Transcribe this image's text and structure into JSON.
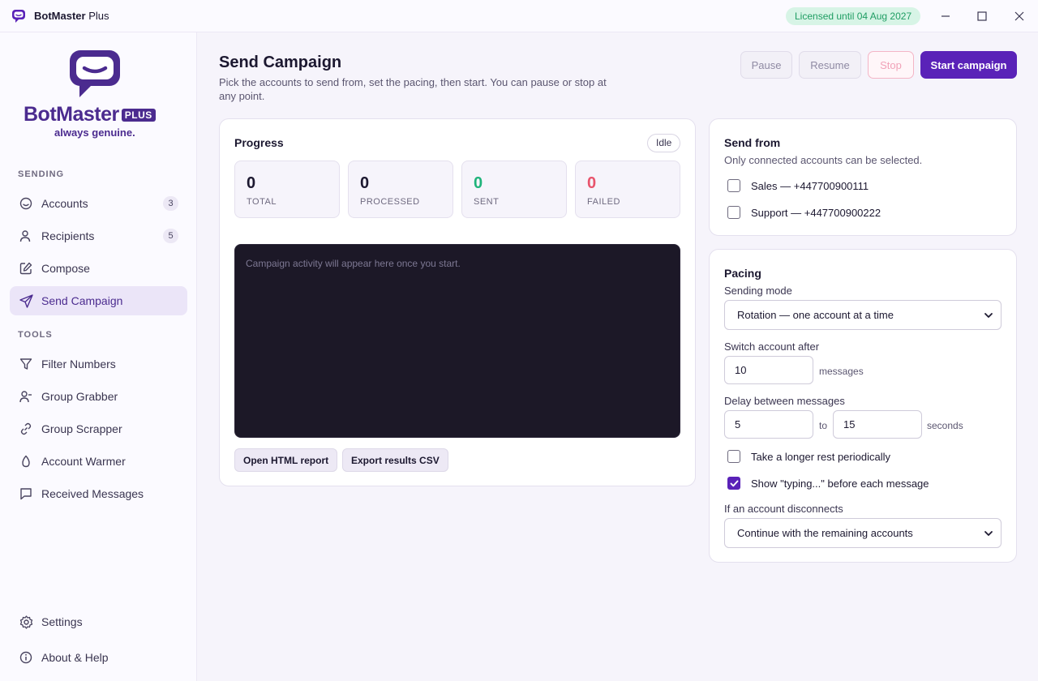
{
  "app": {
    "name_bold": "BotMaster",
    "name_rest": " Plus",
    "license": "Licensed until 04 Aug 2027"
  },
  "brand": {
    "name": "BotMaster",
    "plus": "PLUS",
    "tagline": "always genuine."
  },
  "sidebar": {
    "sending_label": "SENDING",
    "tools_label": "TOOLS",
    "sending_items": [
      {
        "label": "Accounts",
        "badge": "3"
      },
      {
        "label": "Recipients",
        "badge": "5"
      },
      {
        "label": "Compose"
      },
      {
        "label": "Send Campaign"
      }
    ],
    "tools_items": [
      {
        "label": "Filter Numbers"
      },
      {
        "label": "Group Grabber"
      },
      {
        "label": "Group Scrapper"
      },
      {
        "label": "Account Warmer"
      },
      {
        "label": "Received Messages"
      }
    ],
    "footer_items": [
      {
        "label": "Settings"
      },
      {
        "label": "About & Help"
      }
    ]
  },
  "header": {
    "title": "Send Campaign",
    "subtitle": "Pick the accounts to send from, set the pacing, then start. You can pause or stop at any point.",
    "pause": "Pause",
    "resume": "Resume",
    "stop": "Stop",
    "start": "Start campaign"
  },
  "progress": {
    "title": "Progress",
    "status": "Idle",
    "stats": [
      {
        "value": "0",
        "label": "TOTAL"
      },
      {
        "value": "0",
        "label": "PROCESSED"
      },
      {
        "value": "0",
        "label": "SENT"
      },
      {
        "value": "0",
        "label": "FAILED"
      }
    ],
    "console_placeholder": "Campaign activity will appear here once you start.",
    "open_report": "Open HTML report",
    "export_csv": "Export results CSV"
  },
  "send_from": {
    "title": "Send from",
    "note": "Only connected accounts can be selected.",
    "accounts": [
      {
        "label": "Sales — +447700900111",
        "checked": false
      },
      {
        "label": "Support — +447700900222",
        "checked": false
      }
    ]
  },
  "pacing": {
    "title": "Pacing",
    "mode_label": "Sending mode",
    "mode_value": "Rotation — one account at a time",
    "switch_label": "Switch account after",
    "switch_value": "10",
    "switch_unit": "messages",
    "delay_label": "Delay between messages",
    "delay_min": "5",
    "delay_to": "to",
    "delay_max": "15",
    "delay_unit": "seconds",
    "rest_label": "Take a longer rest periodically",
    "rest_checked": false,
    "typing_label": "Show \"typing...\" before each message",
    "typing_checked": true,
    "disconnect_label": "If an account disconnects",
    "disconnect_value": "Continue with the remaining accounts"
  },
  "colors": {
    "accent": "#5a22b8",
    "brand": "#4b2b8f",
    "sent": "#1fb37a",
    "failed": "#e8546c",
    "license_bg": "#d7f4e6",
    "license_text": "#1f9d63"
  }
}
